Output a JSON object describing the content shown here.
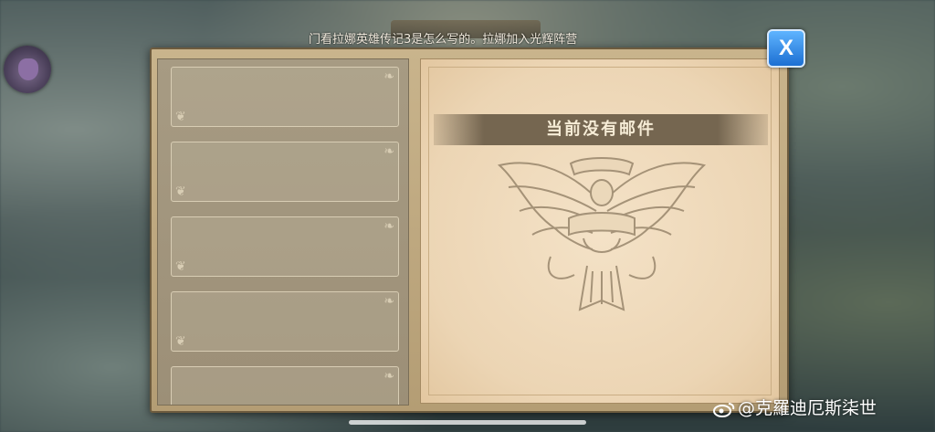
{
  "announcement": {
    "marquee_text": "门看拉娜英雄传记3是怎么写的。拉娜加入光辉阵营"
  },
  "mail_window": {
    "empty_message": "当前没有邮件",
    "close_label": "X",
    "slot_count": 5
  },
  "watermark": {
    "text": "@克羅迪厄斯柒世"
  },
  "colors": {
    "close_button": "#1c6fd2",
    "banner": "#756650",
    "parchment": "#f4e2c7"
  },
  "icons": {
    "close": "close-icon",
    "avatar": "avatar-icon",
    "emblem": "eagle-crest-emblem",
    "weibo": "weibo-icon"
  }
}
